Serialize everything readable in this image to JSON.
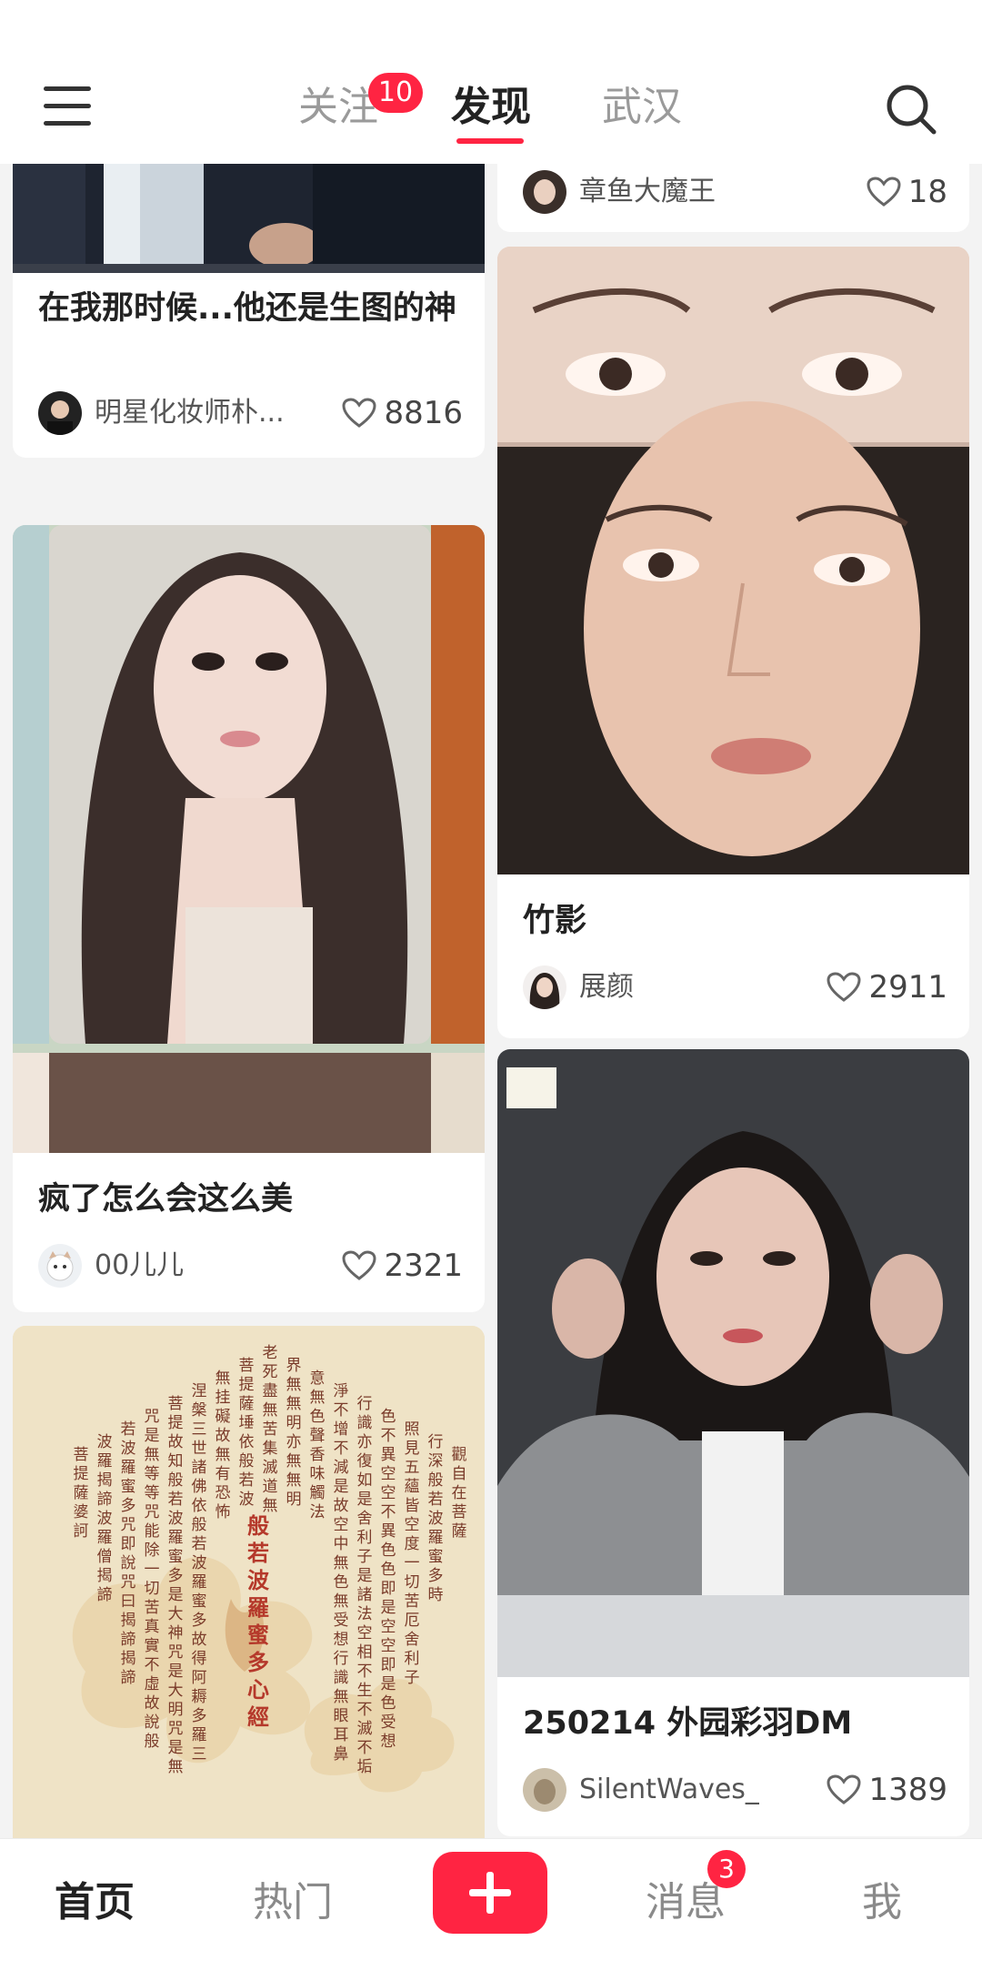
{
  "header": {
    "tabs": [
      {
        "label": "关注",
        "badge": "10"
      },
      {
        "label": "发现",
        "active": true
      },
      {
        "label": "武汉"
      }
    ],
    "menu_icon": "hamburger-menu-icon",
    "search_icon": "search-icon"
  },
  "feed": {
    "left": [
      {
        "title": "在我那时候...他还是生图的神",
        "author": "明星化妆师朴...",
        "likes": "8816"
      },
      {
        "title": "疯了怎么会这么美",
        "author": "00儿儿",
        "likes": "2321"
      },
      {
        "title": "",
        "author": "",
        "likes": ""
      }
    ],
    "right": [
      {
        "title": "",
        "author": "章鱼大魔王",
        "likes": "18"
      },
      {
        "title": "竹影",
        "author": "展颜",
        "likes": "2911"
      },
      {
        "title": "250214 外园彩羽DM",
        "author": "SilentWaves_",
        "likes": "1389"
      }
    ],
    "sutra_image": {
      "title": "般若波羅蜜多心經",
      "columns": [
        "觀自在菩薩",
        "行深般若波羅蜜多時",
        "照見五蘊皆空度一切苦厄舍利子",
        "色不異空空不異色色即是空空即是色受想",
        "行識亦復如是舍利子是諸法空相不生不滅不垢",
        "淨不增不減是故空中無色無受想行識無眼耳鼻",
        "意無色聲香味觸法",
        "界無無明亦無無明",
        "老死盡無苦集滅道無",
        "菩提薩埵依般若波",
        "無挂礙故無有恐怖",
        "涅槃三世諸佛依般若波羅蜜多故得阿耨多羅三",
        "菩提故知般若波羅蜜多是大神咒是大明咒是無",
        "咒是無等等咒能除一切苦真實不虛故說般",
        "若波羅蜜多咒即說咒曰揭諦揭諦",
        "波羅揭諦波羅僧揭諦",
        "菩提薩婆訶"
      ]
    }
  },
  "bottom_nav": {
    "items": [
      {
        "label": "首页",
        "active": true
      },
      {
        "label": "热门"
      },
      {
        "label": "消息",
        "badge": "3"
      },
      {
        "label": "我"
      }
    ],
    "post_icon": "plus-icon"
  },
  "colors": {
    "accent": "#ff2442",
    "text_primary": "#222222",
    "text_secondary": "#9a9a9a",
    "background": "#f3f3f3"
  }
}
